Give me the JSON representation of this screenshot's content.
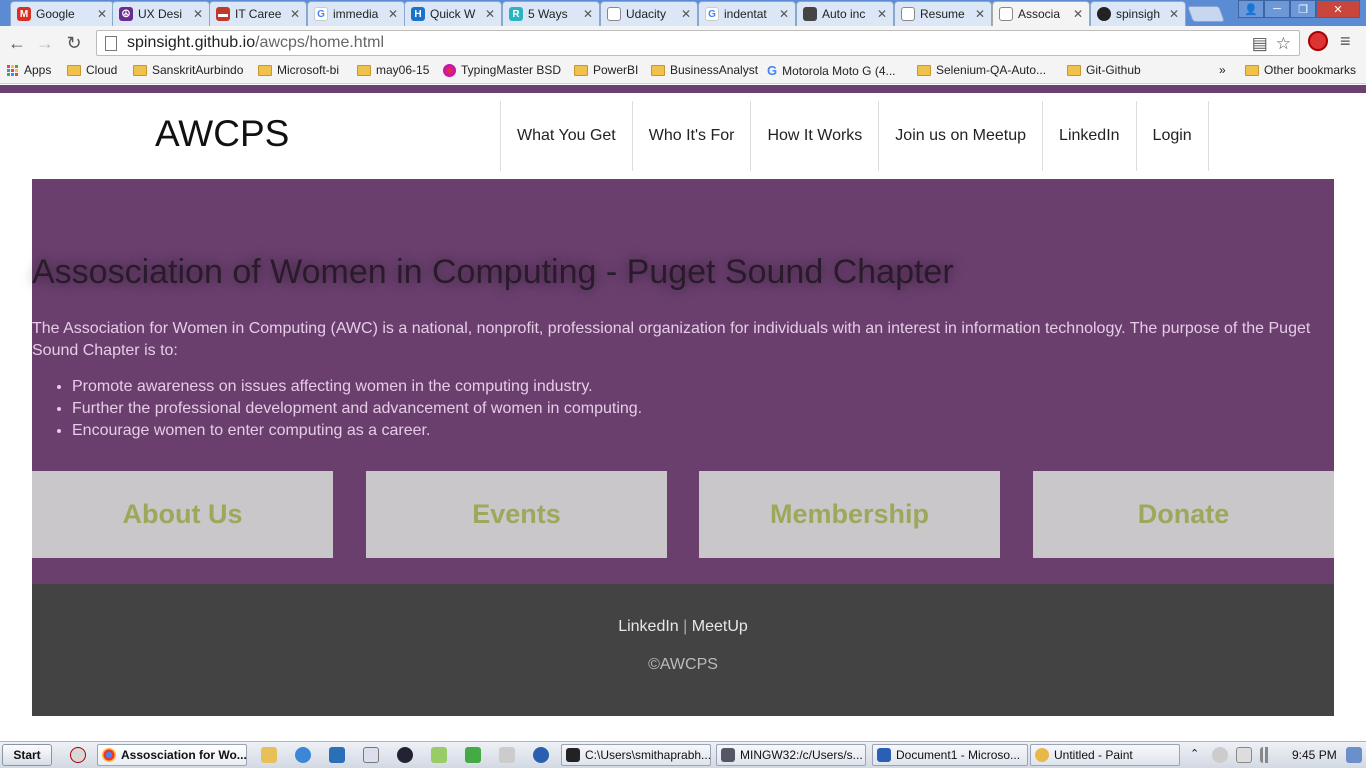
{
  "browser": {
    "tabs": [
      {
        "label": "Google",
        "icon": "gmail-icon",
        "color": "#d93025"
      },
      {
        "label": "UX Desi",
        "icon": "peace-icon",
        "color": "#6a2c91"
      },
      {
        "label": "IT Caree",
        "icon": "site-icon",
        "color": "#c0392b"
      },
      {
        "label": "immedia",
        "icon": "google-icon",
        "color": "#4285f4"
      },
      {
        "label": "Quick W",
        "icon": "h-icon",
        "color": "#1a73c8"
      },
      {
        "label": "5 Ways",
        "icon": "r-icon",
        "color": "#2bb3c0"
      },
      {
        "label": "Udacity",
        "icon": "page-icon",
        "color": "#888888"
      },
      {
        "label": "indentat",
        "icon": "google-icon",
        "color": "#4285f4"
      },
      {
        "label": "Auto inc",
        "icon": "avatar-icon",
        "color": "#444444"
      },
      {
        "label": "Resume",
        "icon": "page-icon",
        "color": "#888888"
      },
      {
        "label": "Associa",
        "icon": "page-icon",
        "color": "#888888",
        "active": true
      },
      {
        "label": "spinsigh",
        "icon": "github-icon",
        "color": "#222222"
      }
    ],
    "url_host": "spinsight.github.io",
    "url_path": "/awcps/home.html",
    "bookmarks": [
      {
        "label": "Apps"
      },
      {
        "label": "Cloud"
      },
      {
        "label": "SanskritAurbindo"
      },
      {
        "label": "Microsoft-bi"
      },
      {
        "label": "may06-15"
      },
      {
        "label": "TypingMaster BSD"
      },
      {
        "label": "PowerBI"
      },
      {
        "label": "BusinessAnalyst"
      },
      {
        "label": "Motorola Moto G (4..."
      },
      {
        "label": "Selenium-QA-Auto..."
      },
      {
        "label": "Git-Github"
      },
      {
        "label": "»"
      },
      {
        "label": "Other bookmarks"
      }
    ]
  },
  "site": {
    "logo": "AWCPS",
    "nav": [
      "What You Get",
      "Who It's For",
      "How It Works",
      "Join us on Meetup",
      "LinkedIn",
      "Login"
    ],
    "heading": "Assosciation of Women in Computing - Puget Sound Chapter",
    "intro": "The Association for Women in Computing (AWC) is a national, nonprofit, professional organization for individuals with an interest in information technology. The purpose of the Puget Sound Chapter is to:",
    "bullets": [
      "Promote awareness on issues affecting women in the computing industry.",
      "Further the professional development and advancement of women in computing.",
      "Encourage women to enter computing as a career."
    ],
    "cards": [
      "About Us",
      "Events",
      "Membership",
      "Donate"
    ],
    "footer": {
      "link1": "LinkedIn",
      "separator": "|",
      "link2": "MeetUp",
      "copyright": "©AWCPS"
    },
    "colors": {
      "accent": "#6a3f6e",
      "card_text": "#9ea85b",
      "footer_bg": "#434343"
    }
  },
  "taskbar": {
    "start": "Start",
    "tasks": [
      "Assosciation for Wo...",
      "C:\\Users\\smithaprabh...",
      "MINGW32:/c/Users/s...",
      "Document1 - Microso...",
      "Untitled - Paint"
    ],
    "clock": "9:45 PM"
  }
}
